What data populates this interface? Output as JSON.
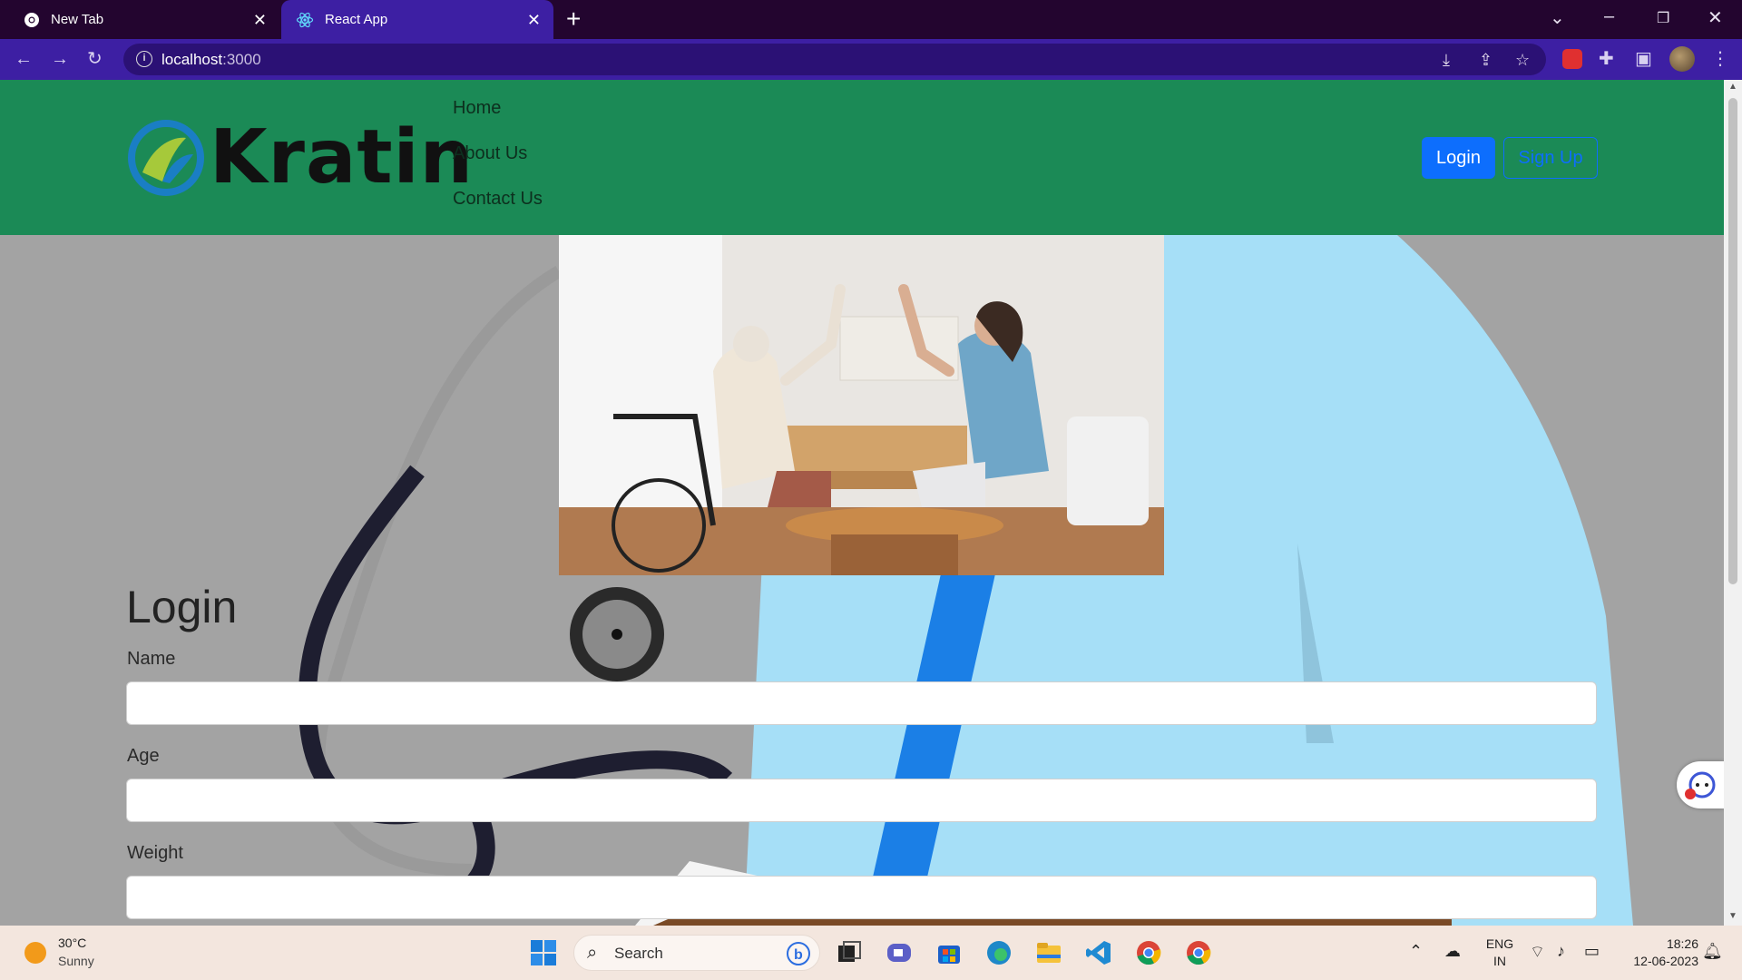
{
  "browser": {
    "tabs": [
      {
        "label": "New Tab",
        "active": false
      },
      {
        "label": "React App",
        "active": true
      }
    ],
    "new_tab_symbol": "+",
    "close_symbol": "✕",
    "address": {
      "host": "localhost",
      "port": ":3000"
    }
  },
  "site": {
    "logo_text": "Kratin",
    "nav": {
      "home": "Home",
      "about": "About Us",
      "contact": "Contact Us"
    },
    "buttons": {
      "login": "Login",
      "signup": "Sign Up"
    },
    "form": {
      "title": "Login",
      "name_label": "Name",
      "age_label": "Age",
      "weight_label": "Weight"
    },
    "colors": {
      "navbar": "#1b8a56",
      "primary": "#0d6efd"
    }
  },
  "taskbar": {
    "weather": {
      "temp": "30°C",
      "desc": "Sunny"
    },
    "search_placeholder": "Search",
    "lang": {
      "line1": "ENG",
      "line2": "IN"
    },
    "clock": {
      "time": "18:26",
      "date": "12-06-2023"
    }
  }
}
